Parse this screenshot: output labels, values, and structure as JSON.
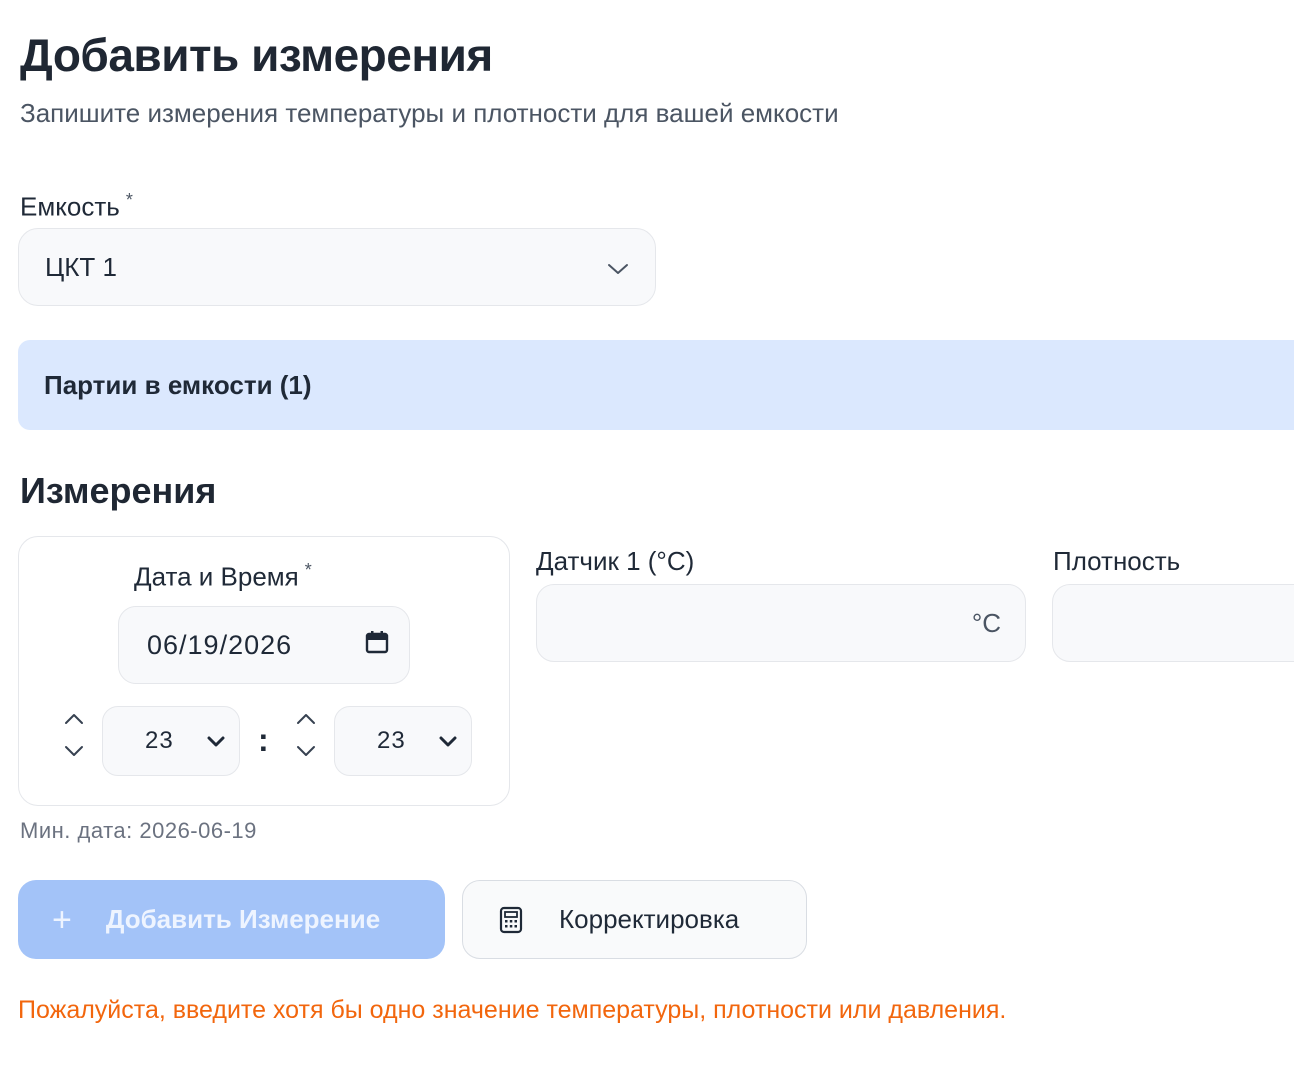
{
  "page": {
    "title": "Добавить измерения",
    "subtitle": "Запишите измерения температуры и плотности для вашей емкости"
  },
  "tank": {
    "label": "Емкость",
    "required_mark": "*",
    "selected": "ЦКТ 1",
    "icon": "chevron-down-icon"
  },
  "batches": {
    "label": "Партии в емкости (1)",
    "color": "#dbe8fe"
  },
  "measurements": {
    "section_title": "Измерения",
    "datetime": {
      "label": "Дата и Время",
      "required_mark": "*",
      "date_value": "06/19/2026",
      "hour": "23",
      "minute": "23",
      "separator": ":",
      "min_date_text": "Мин. дата: 2026-06-19"
    },
    "sensor1": {
      "label": "Датчик 1 (°C)",
      "value": "",
      "unit": "°C"
    },
    "density": {
      "label": "Плотность",
      "value": ""
    }
  },
  "actions": {
    "add_plus": "+",
    "add_label": "Добавить Измерение",
    "add_color": "#a3c3f8",
    "correction_label": "Корректировка",
    "correction_icon": "calculator-icon"
  },
  "error_message": "Пожалуйста, введите хотя бы одно значение температуры, плотности или давления.",
  "colors": {
    "error": "#f2660d",
    "field_bg": "#f8f9fb"
  }
}
